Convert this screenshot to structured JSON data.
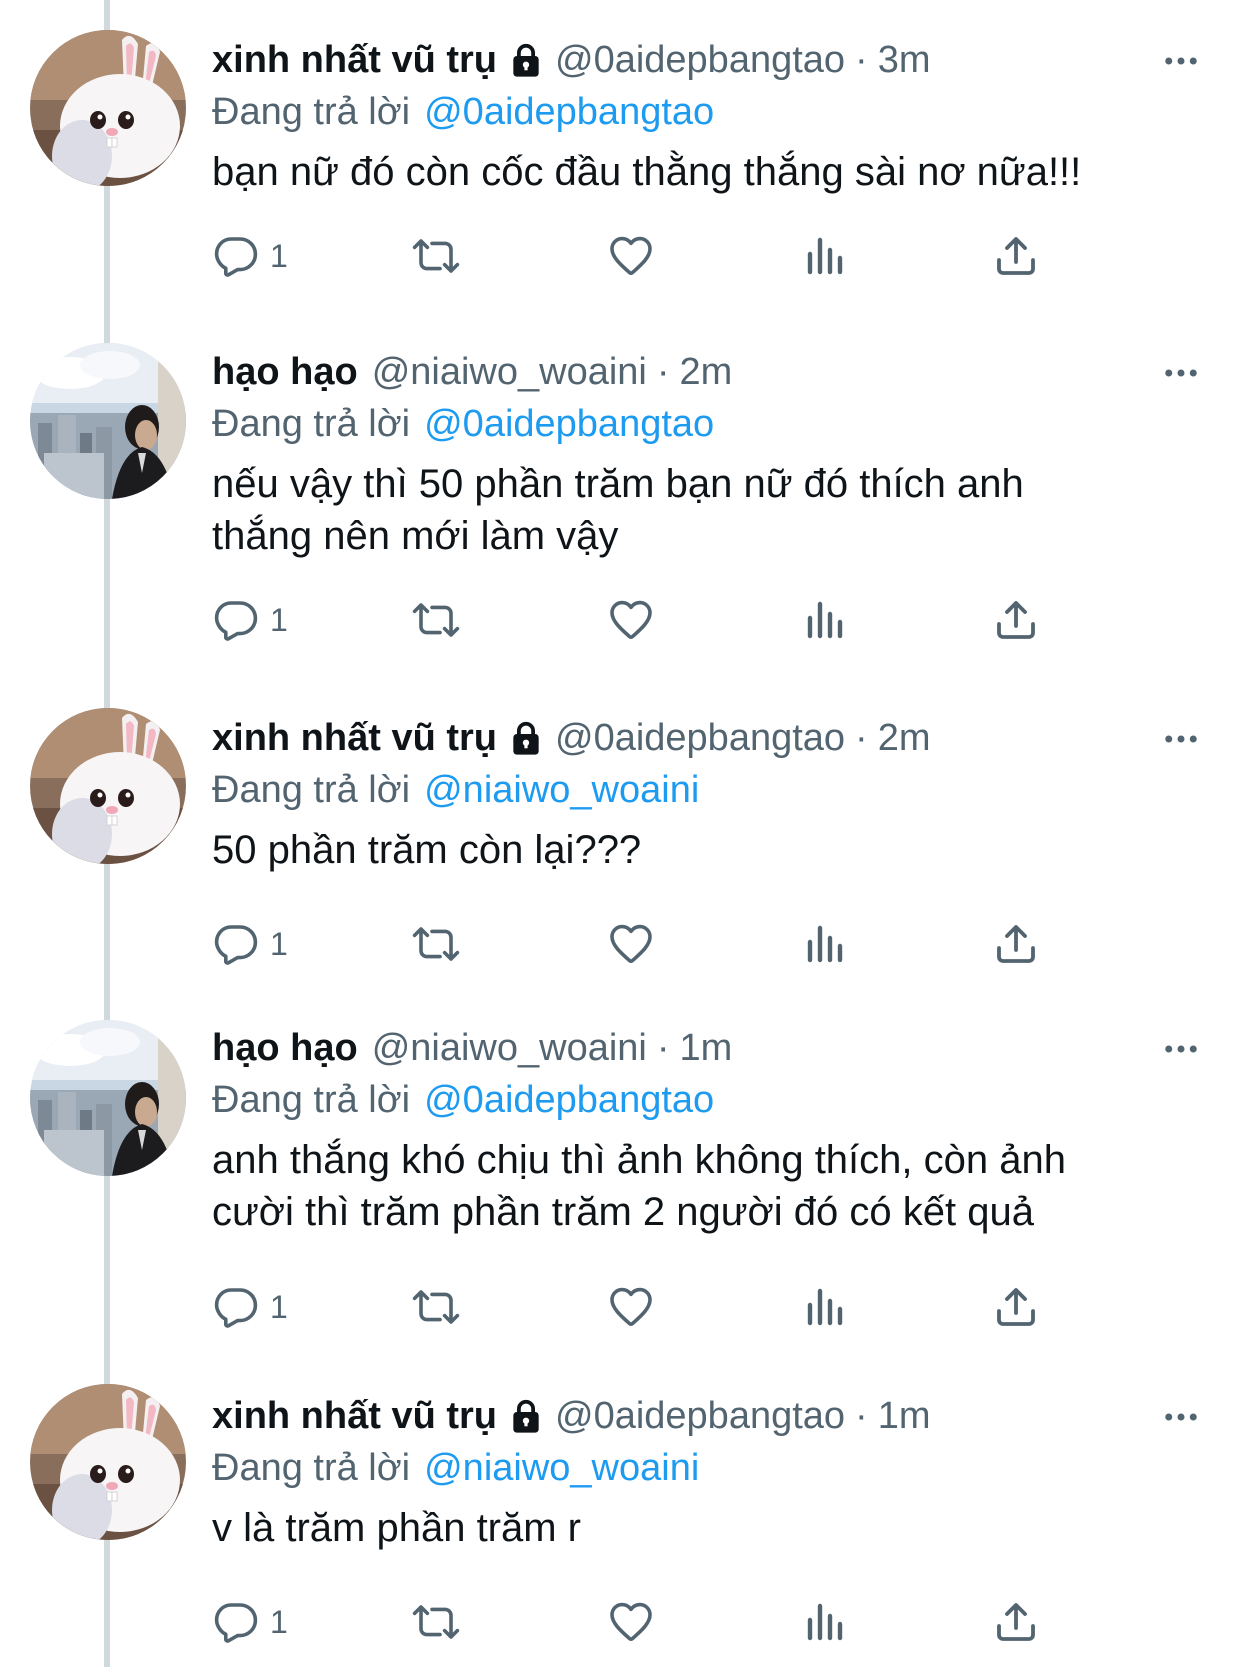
{
  "colors": {
    "text": "#0f1419",
    "secondary": "#536471",
    "link": "#1d9bf0",
    "thread_line": "#cfd9de"
  },
  "icons": {
    "reply": "reply-icon",
    "retweet": "retweet-icon",
    "like": "heart-icon",
    "views": "views-icon",
    "share": "share-icon",
    "more": "more-icon",
    "lock": "lock-icon"
  },
  "tweets": [
    {
      "display_name": "xinh nhất vũ trụ",
      "locked": true,
      "handle": "@0aidepbangtao",
      "dot": "·",
      "time": "3m",
      "reply_prefix": "Đang trả lời",
      "reply_to": "@0aidepbangtao",
      "text": "bạn nữ đó còn cốc đầu thằng thắng sài nơ nữa!!!",
      "reply_count": "1",
      "avatar": "rabbit"
    },
    {
      "display_name": "hạo hạo",
      "locked": false,
      "handle": "@niaiwo_woaini",
      "dot": "·",
      "time": "2m",
      "reply_prefix": "Đang trả lời",
      "reply_to": "@0aidepbangtao",
      "text_lines": [
        "nếu vậy thì 50 phần trăm bạn nữ đó thích anh",
        "thắng nên mới làm vậy"
      ],
      "reply_count": "1",
      "avatar": "city"
    },
    {
      "display_name": "xinh nhất vũ trụ",
      "locked": true,
      "handle": "@0aidepbangtao",
      "dot": "·",
      "time": "2m",
      "reply_prefix": "Đang trả lời",
      "reply_to": "@niaiwo_woaini",
      "text": "50 phần trăm còn lại???",
      "reply_count": "1",
      "avatar": "rabbit"
    },
    {
      "display_name": "hạo hạo",
      "locked": false,
      "handle": "@niaiwo_woaini",
      "dot": "·",
      "time": "1m",
      "reply_prefix": "Đang trả lời",
      "reply_to": "@0aidepbangtao",
      "text_lines": [
        "anh thắng khó chịu thì ảnh không thích, còn ảnh",
        "cười thì trăm phần trăm 2 người đó có kết quả"
      ],
      "reply_count": "1",
      "avatar": "city"
    },
    {
      "display_name": "xinh nhất vũ trụ",
      "locked": true,
      "handle": "@0aidepbangtao",
      "dot": "·",
      "time": "1m",
      "reply_prefix": "Đang trả lời",
      "reply_to": "@niaiwo_woaini",
      "text": "v là trăm phần trăm r",
      "reply_count": "1",
      "avatar": "rabbit"
    }
  ]
}
